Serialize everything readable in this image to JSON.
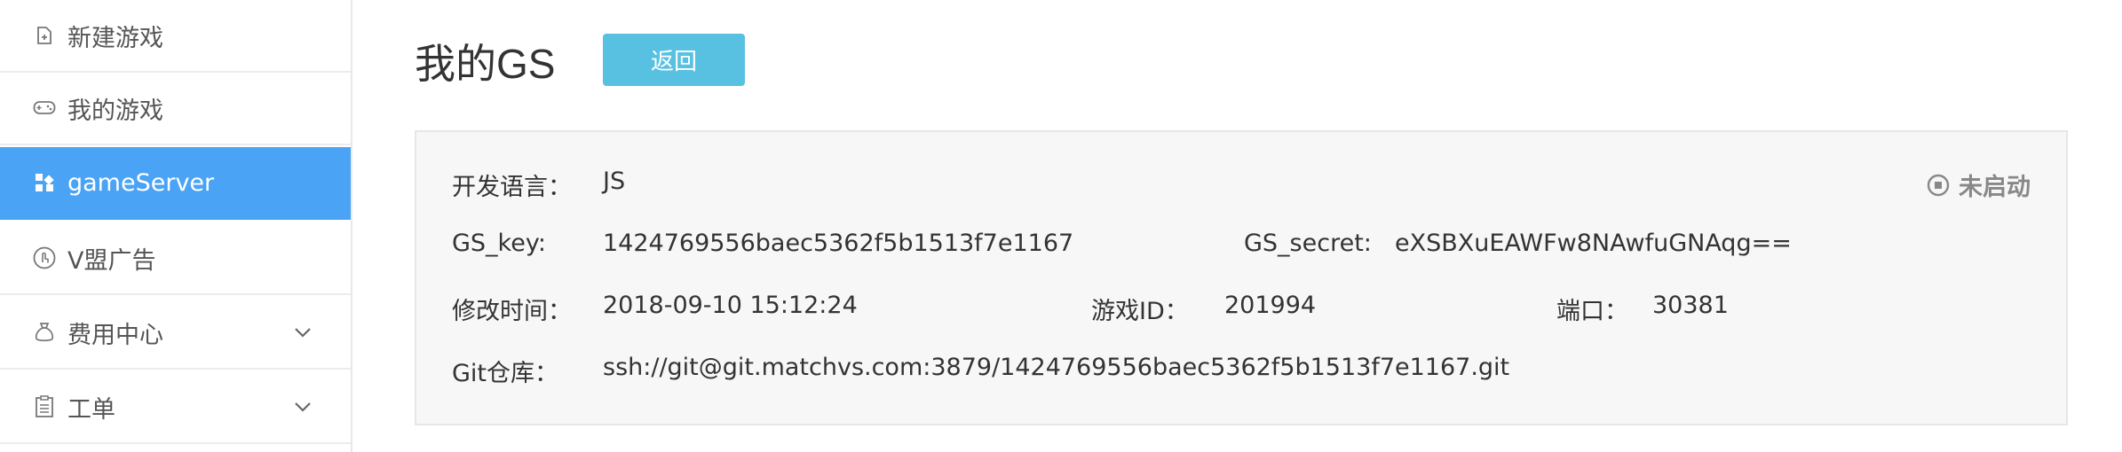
{
  "sidebar": {
    "items": [
      {
        "label": "新建游戏",
        "icon": "new-file-icon"
      },
      {
        "label": "我的游戏",
        "icon": "gamepad-icon"
      },
      {
        "label": "gameServer",
        "icon": "grid-icon",
        "active": true
      },
      {
        "label": "V盟广告",
        "icon": "hand-pointer-icon"
      },
      {
        "label": "费用中心",
        "icon": "money-bag-icon",
        "expandable": true
      },
      {
        "label": "工单",
        "icon": "clipboard-icon",
        "expandable": true
      }
    ]
  },
  "main": {
    "title": "我的GS",
    "back_label": "返回",
    "info": {
      "lang_label": "开发语言：",
      "lang_value": "JS",
      "status": "未启动",
      "key_label": "GS_key:",
      "key_value": "1424769556baec5362f5b1513f7e1167",
      "secret_label": "GS_secret:",
      "secret_value": "eXSBXuEAWFw8NAwfuGNAqg==",
      "modified_label": "修改时间：",
      "modified_value": "2018-09-10 15:12:24",
      "game_id_label": "游戏ID：",
      "game_id_value": "201994",
      "port_label": "端口：",
      "port_value": "30381",
      "git_label": "Git仓库：",
      "git_value": "ssh://git@git.matchvs.com:3879/1424769556baec5362f5b1513f7e1167.git"
    }
  },
  "colors": {
    "active_nav": "#4aa3f5",
    "back_button": "#58c0e0",
    "status_gray": "#888888"
  }
}
